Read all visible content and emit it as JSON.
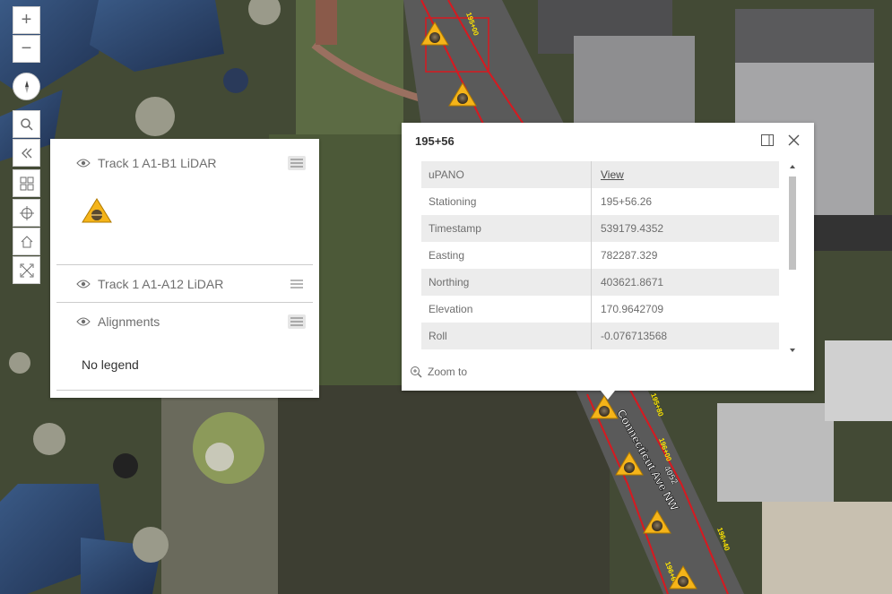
{
  "map": {
    "street_label": "Connecticut Ave NW",
    "road_number": "4052",
    "station_labels": [
      "195+00",
      "195+80",
      "196+00",
      "196+40",
      "196+60"
    ]
  },
  "toolbar": {
    "zoom_in": "+",
    "zoom_out": "−",
    "icons": [
      "compass-icon",
      "search-icon",
      "collapse-icon",
      "basemap-icon",
      "locate-icon",
      "home-icon",
      "fullscreen-icon"
    ]
  },
  "legend": {
    "sections": [
      {
        "title": "Track 1 A1-B1 LiDAR"
      },
      {
        "title": "Track 1 A1-A12 LiDAR"
      },
      {
        "title": "Alignments",
        "note": "No legend"
      }
    ]
  },
  "popup": {
    "title": "195+56",
    "zoom_to": "Zoom to",
    "rows": [
      {
        "key": "uPANO",
        "value": "View"
      },
      {
        "key": "Stationing",
        "value": "195+56.26"
      },
      {
        "key": "Timestamp",
        "value": "539179.4352"
      },
      {
        "key": "Easting",
        "value": "782287.329"
      },
      {
        "key": "Northing",
        "value": "403621.8671"
      },
      {
        "key": "Elevation",
        "value": "170.9642709"
      },
      {
        "key": "Roll",
        "value": "-0.076713568"
      }
    ]
  },
  "colors": {
    "marker_fill": "#f5b419",
    "track_line": "#d71920",
    "label_yellow": "#ffe600"
  }
}
